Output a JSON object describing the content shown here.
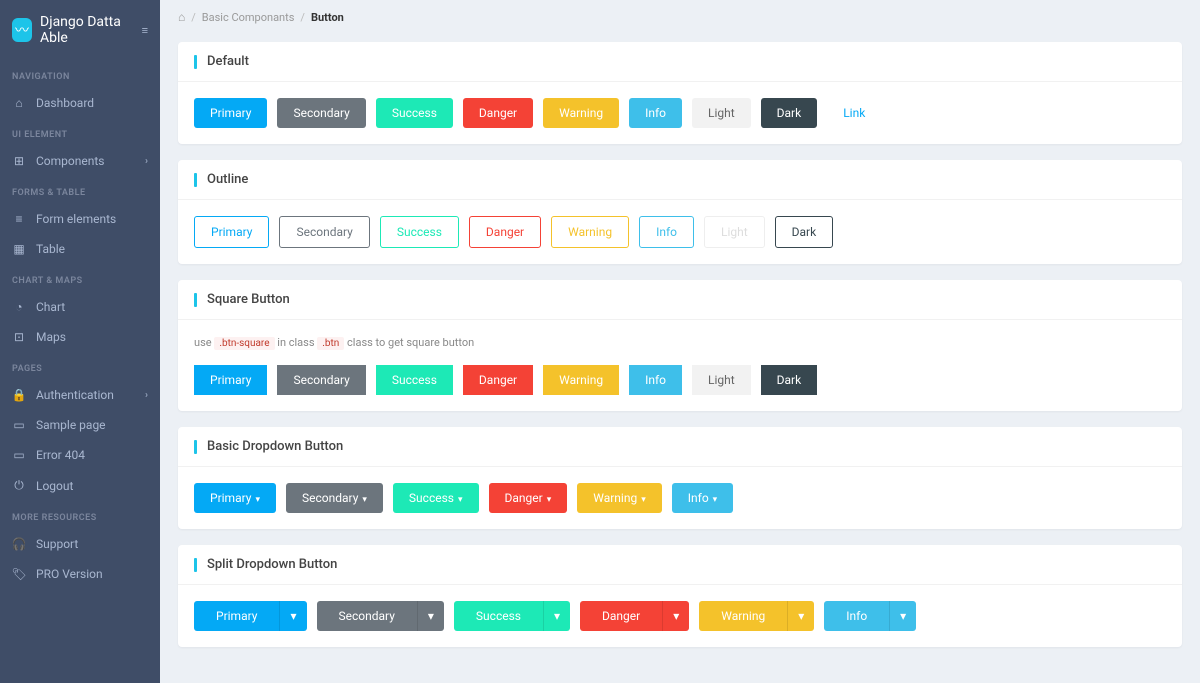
{
  "brand": "Django Datta Able",
  "breadcrumb": {
    "level1": "Basic Componants",
    "current": "Button"
  },
  "sidebar": {
    "sections": [
      {
        "header": "NAVIGATION",
        "items": [
          {
            "label": "Dashboard",
            "icon": "⌂",
            "expand": false
          }
        ]
      },
      {
        "header": "UI ELEMENT",
        "items": [
          {
            "label": "Components",
            "icon": "⊞",
            "expand": true
          }
        ]
      },
      {
        "header": "FORMS & TABLE",
        "items": [
          {
            "label": "Form elements",
            "icon": "≡",
            "expand": false
          },
          {
            "label": "Table",
            "icon": "▦",
            "expand": false
          }
        ]
      },
      {
        "header": "CHART & MAPS",
        "items": [
          {
            "label": "Chart",
            "icon": "◔",
            "expand": false
          },
          {
            "label": "Maps",
            "icon": "⊡",
            "expand": false
          }
        ]
      },
      {
        "header": "PAGES",
        "items": [
          {
            "label": "Authentication",
            "icon": "🔒",
            "expand": true
          },
          {
            "label": "Sample page",
            "icon": "▭",
            "expand": false
          },
          {
            "label": "Error 404",
            "icon": "▭",
            "expand": false
          },
          {
            "label": "Logout",
            "icon": "⏻",
            "expand": false
          }
        ]
      },
      {
        "header": "MORE RESOURCES",
        "items": [
          {
            "label": "Support",
            "icon": "🎧",
            "expand": false
          },
          {
            "label": "PRO Version",
            "icon": "🏷",
            "expand": false
          }
        ]
      }
    ]
  },
  "cards": {
    "default": {
      "title": "Default",
      "buttons": [
        "Primary",
        "Secondary",
        "Success",
        "Danger",
        "Warning",
        "Info",
        "Light",
        "Dark",
        "Link"
      ]
    },
    "outline": {
      "title": "Outline",
      "buttons": [
        "Primary",
        "Secondary",
        "Success",
        "Danger",
        "Warning",
        "Info",
        "Light",
        "Dark"
      ]
    },
    "square": {
      "title": "Square Button",
      "helper_use": "use",
      "helper_code1": ".btn-square",
      "helper_in": "in class",
      "helper_code2": ".btn",
      "helper_rest": "class to get square button",
      "buttons": [
        "Primary",
        "Secondary",
        "Success",
        "Danger",
        "Warning",
        "Info",
        "Light",
        "Dark"
      ]
    },
    "dropdown": {
      "title": "Basic Dropdown Button",
      "buttons": [
        "Primary",
        "Secondary",
        "Success",
        "Danger",
        "Warning",
        "Info"
      ]
    },
    "split": {
      "title": "Split Dropdown Button",
      "buttons": [
        "Primary",
        "Secondary",
        "Success",
        "Danger",
        "Warning",
        "Info"
      ]
    }
  },
  "variant_classes": [
    "btn-primary",
    "btn-secondary",
    "btn-success",
    "btn-danger",
    "btn-warning",
    "btn-info",
    "btn-light",
    "btn-dark",
    "btn-link"
  ],
  "outline_classes": [
    "primary",
    "secondary",
    "success",
    "danger",
    "warning",
    "info",
    "light",
    "dark"
  ]
}
